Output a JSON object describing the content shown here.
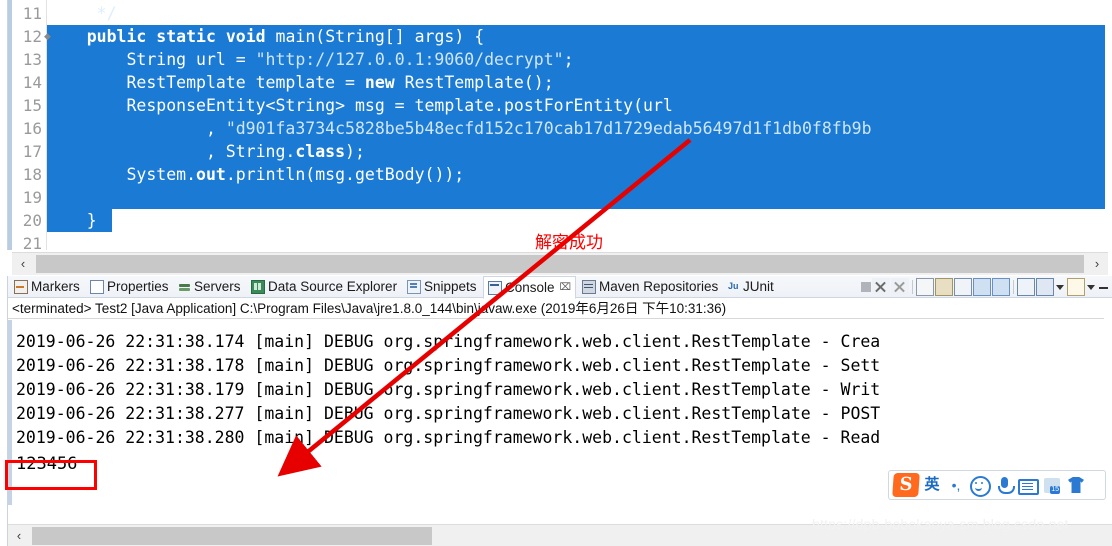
{
  "editor": {
    "line_numbers": [
      "11",
      "12",
      "13",
      "14",
      "15",
      "16",
      "17",
      "18",
      "19",
      "20",
      "21"
    ],
    "fold_marker_line": "12",
    "lines": [
      {
        "num": "11",
        "text": "     */",
        "selected": false
      },
      {
        "num": "12",
        "text": "    public static void main(String[] args) {",
        "selected": true
      },
      {
        "num": "13",
        "text": "        String url = \"http://127.0.0.1:9060/decrypt\";",
        "selected": true
      },
      {
        "num": "14",
        "text": "        RestTemplate template = new RestTemplate();",
        "selected": true
      },
      {
        "num": "15",
        "text": "        ResponseEntity<String> msg = template.postForEntity(url",
        "selected": true
      },
      {
        "num": "16",
        "text": "                , \"d901fa3734c5828be5b48ecfd152c170cab17d1729edab56497d1f1db0f8fb9b",
        "selected": true
      },
      {
        "num": "17",
        "text": "                , String.class);",
        "selected": true
      },
      {
        "num": "18",
        "text": "        System.out.println(msg.getBody());",
        "selected": true
      },
      {
        "num": "19",
        "text": "",
        "selected": true
      },
      {
        "num": "20",
        "text": "    }",
        "selected": true
      },
      {
        "num": "21",
        "text": "",
        "selected": false
      }
    ],
    "scrollbar": {
      "left_arrow": "‹",
      "right_arrow": "›"
    }
  },
  "annotation": {
    "label": "解密成功",
    "color": "#ff0000"
  },
  "panel": {
    "tabs": [
      {
        "label": "Markers",
        "icon": "markers-icon",
        "active": false,
        "closable": false
      },
      {
        "label": "Properties",
        "icon": "properties-icon",
        "active": false,
        "closable": false
      },
      {
        "label": "Servers",
        "icon": "servers-icon",
        "active": false,
        "closable": false
      },
      {
        "label": "Data Source Explorer",
        "icon": "database-icon",
        "active": false,
        "closable": false
      },
      {
        "label": "Snippets",
        "icon": "snippets-icon",
        "active": false,
        "closable": false
      },
      {
        "label": "Console",
        "icon": "console-icon",
        "active": true,
        "closable": true
      },
      {
        "label": "Maven Repositories",
        "icon": "maven-icon",
        "active": false,
        "closable": false
      },
      {
        "label": "JUnit",
        "icon": "junit-icon",
        "active": false,
        "closable": false
      }
    ],
    "close_glyph": "⌧",
    "status_line": "<terminated> Test2 [Java Application] C:\\Program Files\\Java\\jre1.8.0_144\\bin\\javaw.exe (2019年6月26日 下午10:31:36)",
    "toolbar_icons": [
      "terminate-icon",
      "remove-launch-icon",
      "remove-all-terminated-icon",
      "separator",
      "clear-console-icon",
      "scroll-lock-icon",
      "show-console-on-output-icon",
      "pin-console-icon",
      "display-selected-console-icon",
      "open-console-icon",
      "open-console-dropdown-icon",
      "new-console-view-icon",
      "view-menu-dropdown-icon",
      "minimize-icon"
    ]
  },
  "console": {
    "log_lines": [
      "2019-06-26 22:31:38.174 [main] DEBUG org.springframework.web.client.RestTemplate - Crea",
      "2019-06-26 22:31:38.178 [main] DEBUG org.springframework.web.client.RestTemplate - Sett",
      "2019-06-26 22:31:38.179 [main] DEBUG org.springframework.web.client.RestTemplate - Writ",
      "2019-06-26 22:31:38.277 [main] DEBUG org.springframework.web.client.RestTemplate - POST",
      "2019-06-26 22:31:38.280 [main] DEBUG org.springframework.web.client.RestTemplate - Read"
    ],
    "result": "123456",
    "result_highlight_color": "#ff0000",
    "scrollbar": {
      "left_arrow": "‹"
    }
  },
  "ime": {
    "logo": "S",
    "buttons": [
      {
        "name": "language-mode-button",
        "label": "英"
      },
      {
        "name": "punctuation-button",
        "label": "•,"
      },
      {
        "name": "emoji-button",
        "label": ""
      },
      {
        "name": "voice-input-button",
        "label": ""
      },
      {
        "name": "soft-keyboard-button",
        "label": ""
      },
      {
        "name": "calendar-button",
        "label": ""
      },
      {
        "name": "skin-button",
        "label": ""
      }
    ]
  },
  "watermark": {
    "text": "https://dpb-bobokaoya-sm.blog.csdn.net"
  },
  "colors": {
    "selection_blue": "#1a7ad4",
    "annotation_red": "#ff0000",
    "console_text": "#000000"
  }
}
